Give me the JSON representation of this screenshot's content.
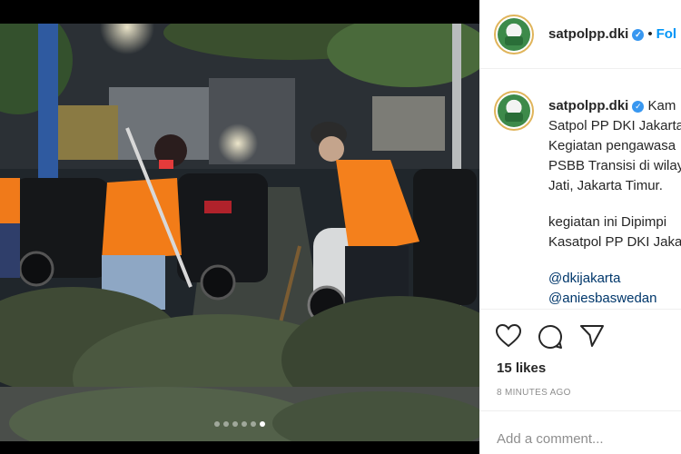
{
  "post": {
    "username": "satpolpp.dki",
    "follow_label": "Fol",
    "separator": "•",
    "caption_lines": [
      "Kam",
      "Satpol PP DKI Jakarta",
      "Kegiatan pengawasa",
      "PSBB Transisi di wilay",
      "Jati, Jakarta Timur.",
      "",
      "kegiatan ini Dipimpi",
      "Kasatpol PP DKI Jaka",
      ""
    ],
    "mentions": [
      "@dkijakarta",
      "@aniesbaswedan"
    ],
    "likes": "15 likes",
    "time": "8 MINUTES AGO",
    "comment_placeholder": "Add a comment..."
  },
  "carousel": {
    "count": 6,
    "active_index": 5
  },
  "icons": {
    "verified": "verified-badge-icon",
    "like": "heart-icon",
    "comment": "comment-bubble-icon",
    "share": "paper-plane-icon"
  },
  "colors": {
    "link": "#0095f6",
    "mention": "#00376b",
    "verified": "#3897f0",
    "muted": "#8e8e8e"
  }
}
